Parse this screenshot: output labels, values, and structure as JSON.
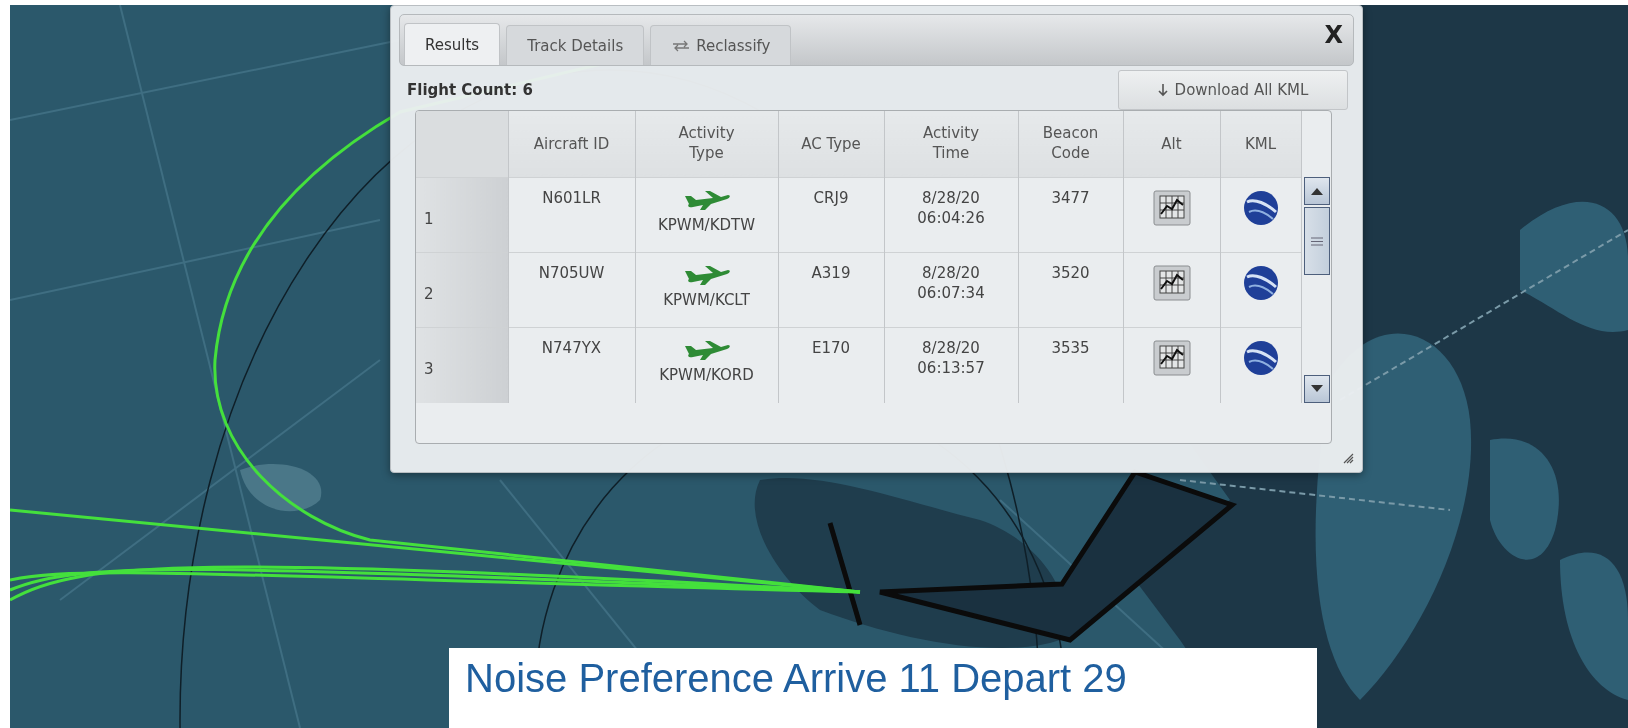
{
  "dialog": {
    "tabs": [
      {
        "label": "Results",
        "selected": true,
        "kind": "view"
      },
      {
        "label": "Track Details",
        "selected": false,
        "kind": "view"
      },
      {
        "label": "Reclassify",
        "selected": false,
        "kind": "action"
      }
    ],
    "close_label": "X",
    "flight_count": "Flight Count: 6",
    "download_button": {
      "label": "Download All KML"
    },
    "table": {
      "columns": [
        "Aircraft ID",
        "Activity Type",
        "AC Type",
        "Activity Time",
        "Beacon Code",
        "Alt",
        "KML"
      ],
      "rows": [
        {
          "number": "1",
          "aircraft_id": "N601LR",
          "route": "KPWM/KDTW",
          "ac_type": "CRJ9",
          "activity_time": "8/28/20 06:04:26",
          "beacon_code": "3477"
        },
        {
          "number": "2",
          "aircraft_id": "N705UW",
          "route": "KPWM/KCLT",
          "ac_type": "A319",
          "activity_time": "8/28/20 06:07:34",
          "beacon_code": "3520"
        },
        {
          "number": "3",
          "aircraft_id": "N747YX",
          "route": "KPWM/KORD",
          "ac_type": "E170",
          "activity_time": "8/28/20 06:13:57",
          "beacon_code": "3535"
        }
      ]
    }
  },
  "caption": "Noise Preference Arrive 11 Depart 29"
}
